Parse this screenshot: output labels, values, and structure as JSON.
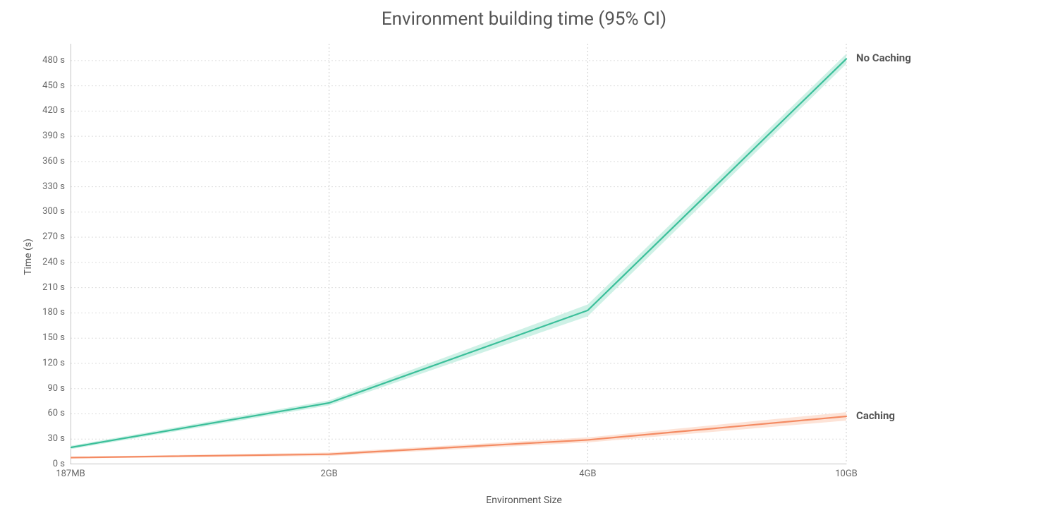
{
  "chart_data": {
    "type": "line",
    "title": "Environment building time (95% CI)",
    "xlabel": "Environment Size",
    "ylabel": "Time (s)",
    "x_categories": [
      "187MB",
      "2GB",
      "4GB",
      "10GB"
    ],
    "ylim": [
      0,
      500
    ],
    "y_ticks": [
      0,
      30,
      60,
      90,
      120,
      150,
      180,
      210,
      240,
      270,
      300,
      330,
      360,
      390,
      420,
      450,
      480
    ],
    "y_tick_labels": [
      "0 s",
      "30 s",
      "60 s",
      "90 s",
      "120 s",
      "150 s",
      "180 s",
      "210 s",
      "240 s",
      "270 s",
      "300 s",
      "330 s",
      "360 s",
      "390 s",
      "420 s",
      "450 s",
      "480 s"
    ],
    "series": [
      {
        "name": "No Caching",
        "color": "#3bbf9a",
        "fill": "#c9efe3",
        "values": [
          20,
          73,
          183,
          482
        ],
        "ci_upper": [
          22,
          76,
          190,
          488
        ],
        "ci_lower": [
          18,
          70,
          176,
          476
        ]
      },
      {
        "name": "Caching",
        "color": "#f48b63",
        "fill": "#fde0d3",
        "values": [
          8,
          12,
          29,
          57
        ],
        "ci_upper": [
          9,
          14,
          32,
          62
        ],
        "ci_lower": [
          7,
          10,
          26,
          52
        ]
      }
    ]
  }
}
